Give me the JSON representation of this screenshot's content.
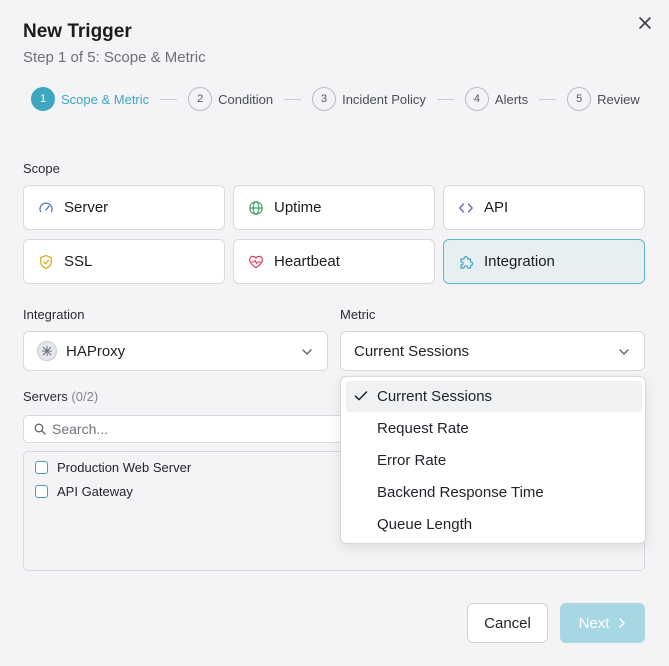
{
  "header": {
    "title": "New Trigger",
    "subtitle": "Step 1 of 5: Scope & Metric"
  },
  "steps": [
    {
      "num": "1",
      "label": "Scope & Metric"
    },
    {
      "num": "2",
      "label": "Condition"
    },
    {
      "num": "3",
      "label": "Incident Policy"
    },
    {
      "num": "4",
      "label": "Alerts"
    },
    {
      "num": "5",
      "label": "Review"
    }
  ],
  "scope": {
    "label": "Scope",
    "options": [
      {
        "label": "Server",
        "icon": "gauge-icon"
      },
      {
        "label": "Uptime",
        "icon": "globe-icon"
      },
      {
        "label": "API",
        "icon": "code-icon"
      },
      {
        "label": "SSL",
        "icon": "shield-check-icon"
      },
      {
        "label": "Heartbeat",
        "icon": "heart-pulse-icon"
      },
      {
        "label": "Integration",
        "icon": "puzzle-icon"
      }
    ],
    "selected": "Integration"
  },
  "integration": {
    "label": "Integration",
    "value": "HAProxy"
  },
  "metric": {
    "label": "Metric",
    "value": "Current Sessions",
    "options": [
      "Current Sessions",
      "Request Rate",
      "Error Rate",
      "Backend Response Time",
      "Queue Length"
    ]
  },
  "servers": {
    "label": "Servers",
    "count": "(0/2)",
    "search_placeholder": "Search...",
    "items": [
      "Production Web Server",
      "API Gateway"
    ]
  },
  "footer": {
    "cancel_label": "Cancel",
    "next_label": "Next"
  },
  "colors": {
    "accent": "#3fa6c0",
    "next_disabled": "#a6d7e3",
    "selected_scope_bg": "#e8eff3"
  }
}
